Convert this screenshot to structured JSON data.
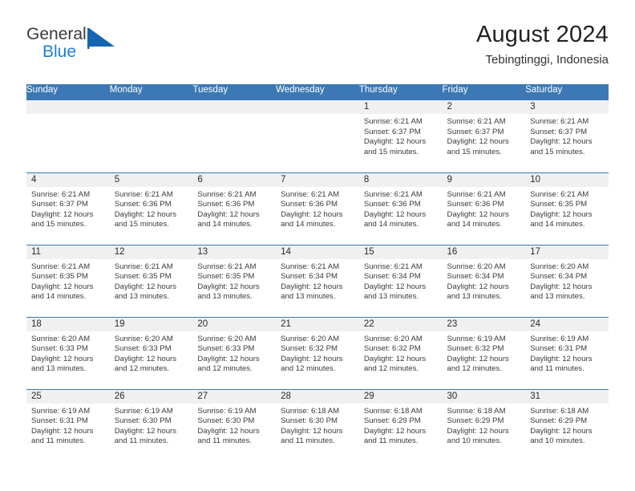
{
  "brand": {
    "name_top": "General",
    "name_bottom": "Blue",
    "mark": "triangle-flag-icon",
    "color_blue": "#1c7fd4",
    "color_dark": "#3a3a3a"
  },
  "header": {
    "title": "August 2024",
    "subtitle": "Tebingtinggi, Indonesia"
  },
  "theme": {
    "header_blue": "#3b78b5",
    "daynum_band": "#f0f0f0",
    "text": "#3a3a3a"
  },
  "weekday_headers": [
    "Sunday",
    "Monday",
    "Tuesday",
    "Wednesday",
    "Thursday",
    "Friday",
    "Saturday"
  ],
  "labels": {
    "sunrise_prefix": "Sunrise:",
    "sunset_prefix": "Sunset:",
    "daylight_prefix": "Daylight:"
  },
  "weeks": [
    [
      {
        "day": "",
        "empty": true
      },
      {
        "day": "",
        "empty": true
      },
      {
        "day": "",
        "empty": true
      },
      {
        "day": "",
        "empty": true
      },
      {
        "day": "1",
        "sunrise": "Sunrise: 6:21 AM",
        "sunset": "Sunset: 6:37 PM",
        "daylight1": "Daylight: 12 hours",
        "daylight2": "and 15 minutes."
      },
      {
        "day": "2",
        "sunrise": "Sunrise: 6:21 AM",
        "sunset": "Sunset: 6:37 PM",
        "daylight1": "Daylight: 12 hours",
        "daylight2": "and 15 minutes."
      },
      {
        "day": "3",
        "sunrise": "Sunrise: 6:21 AM",
        "sunset": "Sunset: 6:37 PM",
        "daylight1": "Daylight: 12 hours",
        "daylight2": "and 15 minutes."
      }
    ],
    [
      {
        "day": "4",
        "sunrise": "Sunrise: 6:21 AM",
        "sunset": "Sunset: 6:37 PM",
        "daylight1": "Daylight: 12 hours",
        "daylight2": "and 15 minutes."
      },
      {
        "day": "5",
        "sunrise": "Sunrise: 6:21 AM",
        "sunset": "Sunset: 6:36 PM",
        "daylight1": "Daylight: 12 hours",
        "daylight2": "and 15 minutes."
      },
      {
        "day": "6",
        "sunrise": "Sunrise: 6:21 AM",
        "sunset": "Sunset: 6:36 PM",
        "daylight1": "Daylight: 12 hours",
        "daylight2": "and 14 minutes."
      },
      {
        "day": "7",
        "sunrise": "Sunrise: 6:21 AM",
        "sunset": "Sunset: 6:36 PM",
        "daylight1": "Daylight: 12 hours",
        "daylight2": "and 14 minutes."
      },
      {
        "day": "8",
        "sunrise": "Sunrise: 6:21 AM",
        "sunset": "Sunset: 6:36 PM",
        "daylight1": "Daylight: 12 hours",
        "daylight2": "and 14 minutes."
      },
      {
        "day": "9",
        "sunrise": "Sunrise: 6:21 AM",
        "sunset": "Sunset: 6:36 PM",
        "daylight1": "Daylight: 12 hours",
        "daylight2": "and 14 minutes."
      },
      {
        "day": "10",
        "sunrise": "Sunrise: 6:21 AM",
        "sunset": "Sunset: 6:35 PM",
        "daylight1": "Daylight: 12 hours",
        "daylight2": "and 14 minutes."
      }
    ],
    [
      {
        "day": "11",
        "sunrise": "Sunrise: 6:21 AM",
        "sunset": "Sunset: 6:35 PM",
        "daylight1": "Daylight: 12 hours",
        "daylight2": "and 14 minutes."
      },
      {
        "day": "12",
        "sunrise": "Sunrise: 6:21 AM",
        "sunset": "Sunset: 6:35 PM",
        "daylight1": "Daylight: 12 hours",
        "daylight2": "and 13 minutes."
      },
      {
        "day": "13",
        "sunrise": "Sunrise: 6:21 AM",
        "sunset": "Sunset: 6:35 PM",
        "daylight1": "Daylight: 12 hours",
        "daylight2": "and 13 minutes."
      },
      {
        "day": "14",
        "sunrise": "Sunrise: 6:21 AM",
        "sunset": "Sunset: 6:34 PM",
        "daylight1": "Daylight: 12 hours",
        "daylight2": "and 13 minutes."
      },
      {
        "day": "15",
        "sunrise": "Sunrise: 6:21 AM",
        "sunset": "Sunset: 6:34 PM",
        "daylight1": "Daylight: 12 hours",
        "daylight2": "and 13 minutes."
      },
      {
        "day": "16",
        "sunrise": "Sunrise: 6:20 AM",
        "sunset": "Sunset: 6:34 PM",
        "daylight1": "Daylight: 12 hours",
        "daylight2": "and 13 minutes."
      },
      {
        "day": "17",
        "sunrise": "Sunrise: 6:20 AM",
        "sunset": "Sunset: 6:34 PM",
        "daylight1": "Daylight: 12 hours",
        "daylight2": "and 13 minutes."
      }
    ],
    [
      {
        "day": "18",
        "sunrise": "Sunrise: 6:20 AM",
        "sunset": "Sunset: 6:33 PM",
        "daylight1": "Daylight: 12 hours",
        "daylight2": "and 13 minutes."
      },
      {
        "day": "19",
        "sunrise": "Sunrise: 6:20 AM",
        "sunset": "Sunset: 6:33 PM",
        "daylight1": "Daylight: 12 hours",
        "daylight2": "and 12 minutes."
      },
      {
        "day": "20",
        "sunrise": "Sunrise: 6:20 AM",
        "sunset": "Sunset: 6:33 PM",
        "daylight1": "Daylight: 12 hours",
        "daylight2": "and 12 minutes."
      },
      {
        "day": "21",
        "sunrise": "Sunrise: 6:20 AM",
        "sunset": "Sunset: 6:32 PM",
        "daylight1": "Daylight: 12 hours",
        "daylight2": "and 12 minutes."
      },
      {
        "day": "22",
        "sunrise": "Sunrise: 6:20 AM",
        "sunset": "Sunset: 6:32 PM",
        "daylight1": "Daylight: 12 hours",
        "daylight2": "and 12 minutes."
      },
      {
        "day": "23",
        "sunrise": "Sunrise: 6:19 AM",
        "sunset": "Sunset: 6:32 PM",
        "daylight1": "Daylight: 12 hours",
        "daylight2": "and 12 minutes."
      },
      {
        "day": "24",
        "sunrise": "Sunrise: 6:19 AM",
        "sunset": "Sunset: 6:31 PM",
        "daylight1": "Daylight: 12 hours",
        "daylight2": "and 11 minutes."
      }
    ],
    [
      {
        "day": "25",
        "sunrise": "Sunrise: 6:19 AM",
        "sunset": "Sunset: 6:31 PM",
        "daylight1": "Daylight: 12 hours",
        "daylight2": "and 11 minutes."
      },
      {
        "day": "26",
        "sunrise": "Sunrise: 6:19 AM",
        "sunset": "Sunset: 6:30 PM",
        "daylight1": "Daylight: 12 hours",
        "daylight2": "and 11 minutes."
      },
      {
        "day": "27",
        "sunrise": "Sunrise: 6:19 AM",
        "sunset": "Sunset: 6:30 PM",
        "daylight1": "Daylight: 12 hours",
        "daylight2": "and 11 minutes."
      },
      {
        "day": "28",
        "sunrise": "Sunrise: 6:18 AM",
        "sunset": "Sunset: 6:30 PM",
        "daylight1": "Daylight: 12 hours",
        "daylight2": "and 11 minutes."
      },
      {
        "day": "29",
        "sunrise": "Sunrise: 6:18 AM",
        "sunset": "Sunset: 6:29 PM",
        "daylight1": "Daylight: 12 hours",
        "daylight2": "and 11 minutes."
      },
      {
        "day": "30",
        "sunrise": "Sunrise: 6:18 AM",
        "sunset": "Sunset: 6:29 PM",
        "daylight1": "Daylight: 12 hours",
        "daylight2": "and 10 minutes."
      },
      {
        "day": "31",
        "sunrise": "Sunrise: 6:18 AM",
        "sunset": "Sunset: 6:29 PM",
        "daylight1": "Daylight: 12 hours",
        "daylight2": "and 10 minutes."
      }
    ]
  ]
}
